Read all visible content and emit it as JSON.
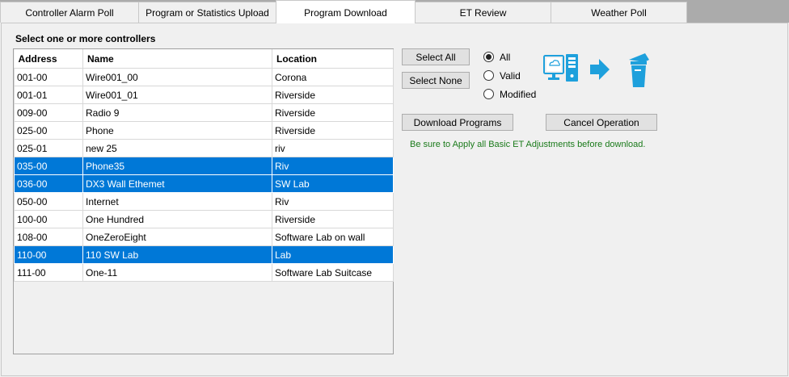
{
  "tabs": [
    {
      "label": "Controller Alarm Poll",
      "active": false
    },
    {
      "label": "Program or Statistics Upload",
      "active": false
    },
    {
      "label": "Program Download",
      "active": true
    },
    {
      "label": "ET Review",
      "active": false
    },
    {
      "label": "Weather Poll",
      "active": false
    }
  ],
  "heading": "Select one or more controllers",
  "table": {
    "columns": [
      "Address",
      "Name",
      "Location"
    ],
    "rows": [
      {
        "address": "001-00",
        "name": "Wire001_00",
        "location": "Corona",
        "selected": false
      },
      {
        "address": "001-01",
        "name": "Wire001_01",
        "location": "Riverside",
        "selected": false
      },
      {
        "address": "009-00",
        "name": "Radio 9",
        "location": "Riverside",
        "selected": false
      },
      {
        "address": "025-00",
        "name": "Phone",
        "location": "Riverside",
        "selected": false
      },
      {
        "address": "025-01",
        "name": "new 25",
        "location": "riv",
        "selected": false
      },
      {
        "address": "035-00",
        "name": "Phone35",
        "location": "Riv",
        "selected": true
      },
      {
        "address": "036-00",
        "name": "DX3 Wall Ethemet",
        "location": "SW Lab",
        "selected": true
      },
      {
        "address": "050-00",
        "name": "Internet",
        "location": "Riv",
        "selected": false
      },
      {
        "address": "100-00",
        "name": "One Hundred",
        "location": "Riverside",
        "selected": false
      },
      {
        "address": "108-00",
        "name": "OneZeroEight",
        "location": "Software Lab on wall",
        "selected": false
      },
      {
        "address": "110-00",
        "name": "110 SW Lab",
        "location": "Lab",
        "selected": true
      },
      {
        "address": "111-00",
        "name": "One-11",
        "location": "Software Lab Suitcase",
        "selected": false
      }
    ]
  },
  "buttons": {
    "select_all": "Select All",
    "select_none": "Select None",
    "download": "Download Programs",
    "cancel": "Cancel Operation"
  },
  "filter": {
    "options": [
      "All",
      "Valid",
      "Modified"
    ],
    "selected": "All"
  },
  "note": "Be sure to Apply all Basic ET Adjustments before download.",
  "colors": {
    "selection": "#0078d7",
    "note": "#1a7a1a",
    "icon": "#1ea0dc"
  },
  "icons": [
    "computer-icon",
    "arrow-right-icon",
    "controller-icon"
  ]
}
